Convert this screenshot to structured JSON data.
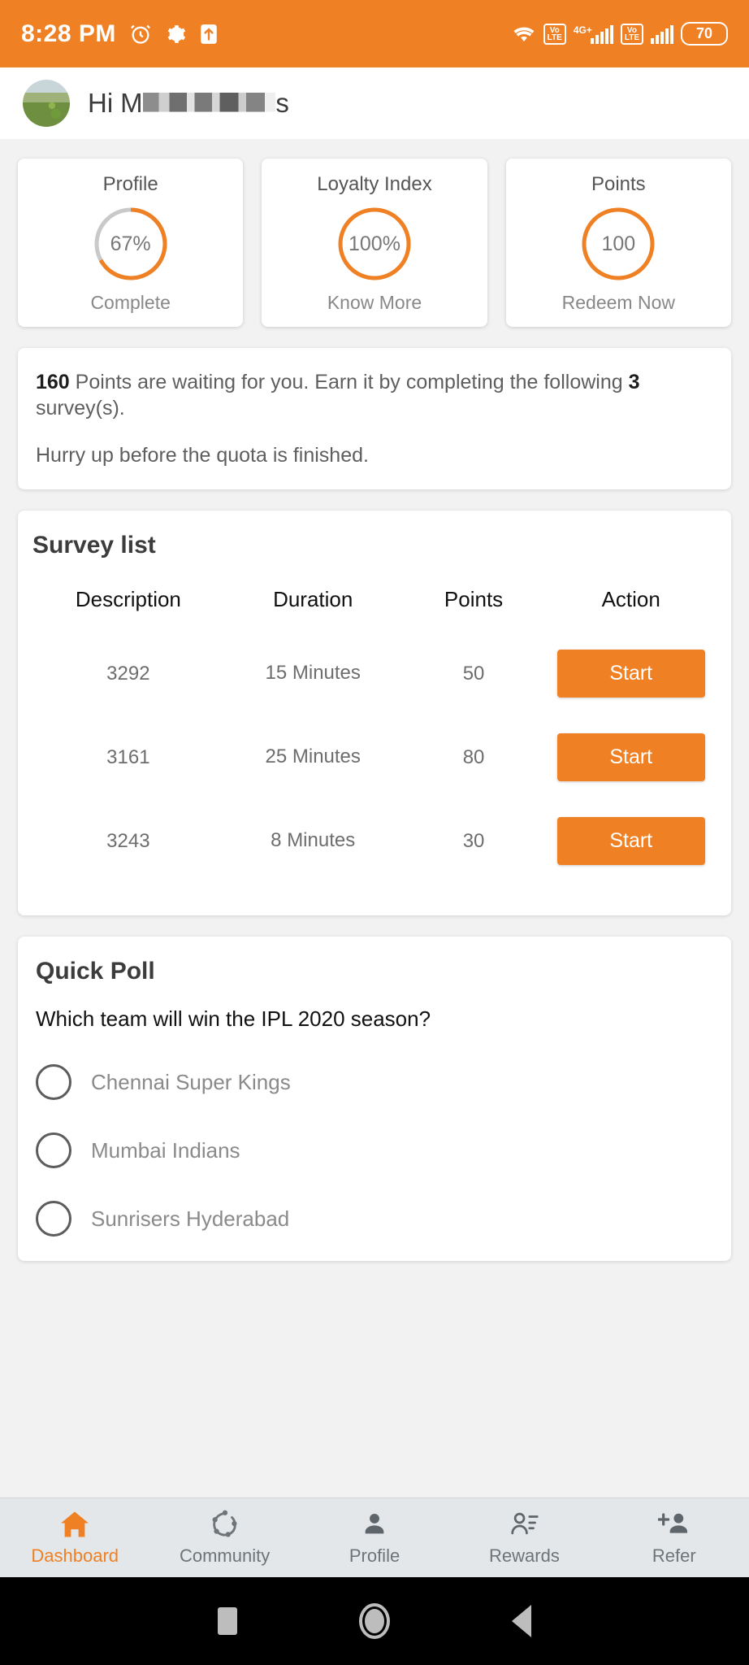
{
  "status_bar": {
    "time": "8:28 PM",
    "alarm_icon": "alarm-icon",
    "settings_icon": "gear-icon",
    "upload_icon": "upload-arrow-icon",
    "wifi_icon": "wifi-icon",
    "volte_label": "VoLTE",
    "network_label": "4G+",
    "battery_percent": "70"
  },
  "header": {
    "greeting_prefix": "Hi",
    "name_visible": "M",
    "name_redacted": "███████",
    "name_suffix": "s"
  },
  "stats": [
    {
      "title": "Profile",
      "value": "67%",
      "sub": "Complete",
      "percent": 67,
      "accent": "#ef8024",
      "track": "#c9c9c9"
    },
    {
      "title": "Loyalty Index",
      "value": "100%",
      "sub": "Know More",
      "percent": 100,
      "accent": "#ef8024",
      "track": "#c9c9c9"
    },
    {
      "title": "Points",
      "value": "100",
      "sub": "Redeem Now",
      "percent": 100,
      "accent": "#ef8024",
      "track": "#c9c9c9"
    }
  ],
  "notice": {
    "points": "160",
    "line1_a": "Points are waiting for you. Earn it by completing the following",
    "survey_count": "3",
    "line1_b": "survey(s).",
    "line2": "Hurry up before the quota is finished."
  },
  "survey_list": {
    "heading": "Survey list",
    "columns": [
      "Description",
      "Duration",
      "Points",
      "Action"
    ],
    "rows": [
      {
        "description": "3292",
        "duration": "15 Minutes",
        "points": "50",
        "action": "Start"
      },
      {
        "description": "3161",
        "duration": "25 Minutes",
        "points": "80",
        "action": "Start"
      },
      {
        "description": "3243",
        "duration": "8 Minutes",
        "points": "30",
        "action": "Start"
      }
    ]
  },
  "quick_poll": {
    "heading": "Quick Poll",
    "question": "Which team will win the IPL 2020 season?",
    "options": [
      {
        "label": "Chennai Super Kings",
        "selected": false
      },
      {
        "label": "Mumbai Indians",
        "selected": false
      },
      {
        "label": "Sunrisers Hyderabad",
        "selected": false
      }
    ]
  },
  "bottom_nav": {
    "active_color": "#ef8024",
    "items": [
      {
        "label": "Dashboard",
        "icon": "home-icon",
        "active": true
      },
      {
        "label": "Community",
        "icon": "community-icon",
        "active": false
      },
      {
        "label": "Profile",
        "icon": "person-icon",
        "active": false
      },
      {
        "label": "Rewards",
        "icon": "person-list-icon",
        "active": false
      },
      {
        "label": "Refer",
        "icon": "person-add-icon",
        "active": false
      }
    ]
  },
  "system_bar": {
    "recents": "square-icon",
    "home": "circle-icon",
    "back": "triangle-back-icon"
  }
}
